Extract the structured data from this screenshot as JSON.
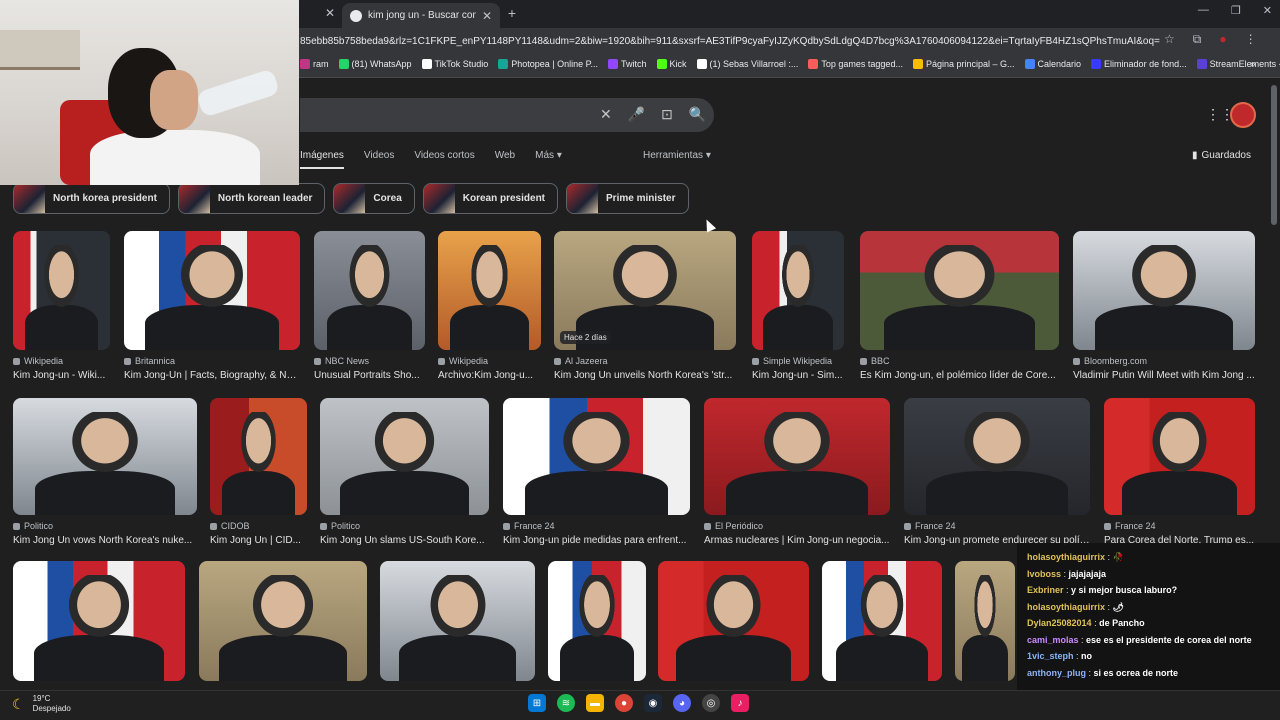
{
  "browser": {
    "active_tab_title": "kim jong un - Buscar con Goog",
    "url": "85ebb85b758beda9&rlz=1C1FKPE_enPY1148PY1148&udm=2&biw=1920&bih=911&sxsrf=AE3TifP9cyaFyIJZyKQdbySdLdgQ4D7bcg%3A1760406094122&ei=TqrtaIyFB4HZ1sQPhsTmuAI&oq=KIM+JON&gs_l...",
    "bookmarks": [
      {
        "label": "ram",
        "color": "#c13584"
      },
      {
        "label": "(81) WhatsApp",
        "color": "#25d366"
      },
      {
        "label": "TikTok Studio",
        "color": "#ffffff"
      },
      {
        "label": "Photopea | Online P...",
        "color": "#18a497"
      },
      {
        "label": "Twitch",
        "color": "#9146ff"
      },
      {
        "label": "Kick",
        "color": "#53fc18"
      },
      {
        "label": "(1) Sebas Villarroel :...",
        "color": "#ffffff"
      },
      {
        "label": "Top games tagged...",
        "color": "#fa5c5c"
      },
      {
        "label": "Página principal – G...",
        "color": "#fbbc04"
      },
      {
        "label": "Calendario",
        "color": "#4285f4"
      },
      {
        "label": "Eliminador de fond...",
        "color": "#3a3aff"
      },
      {
        "label": "StreamElements - O...",
        "color": "#5a3fd9"
      }
    ]
  },
  "google": {
    "tabs": [
      "Imágenes",
      "Videos",
      "Videos cortos",
      "Web",
      "Más"
    ],
    "tools_label": "Herramientas",
    "saved_label": "Guardados",
    "chips": [
      "North korea president",
      "North korean leader",
      "Corea",
      "Korean president",
      "Prime minister"
    ],
    "results_row1": [
      {
        "source": "Wikipedia",
        "title": "Kim Jong-un - Wiki..."
      },
      {
        "source": "Britannica",
        "title": "Kim Jong-Un | Facts, Biography, & Nu..."
      },
      {
        "source": "NBC News",
        "title": "Unusual Portraits Sho..."
      },
      {
        "source": "Wikipedia",
        "title": "Archivo:Kim Jong-u..."
      },
      {
        "source": "Al Jazeera",
        "title": "Kim Jong Un unveils North Korea's 'str...",
        "badge": "Hace 2 días"
      },
      {
        "source": "Simple Wikipedia",
        "title": "Kim Jong-un - Sim..."
      },
      {
        "source": "BBC",
        "title": "Es Kim Jong-un, el polémico líder de Core..."
      },
      {
        "source": "Bloomberg.com",
        "title": "Vladimir Putin Will Meet with Kim Jong ..."
      }
    ],
    "results_row2": [
      {
        "source": "Politico",
        "title": "Kim Jong Un vows North Korea's nuke..."
      },
      {
        "source": "CIDOB",
        "title": "Kim Jong Un | CID..."
      },
      {
        "source": "Politico",
        "title": "Kim Jong Un slams US-South Kore..."
      },
      {
        "source": "France 24",
        "title": "Kim Jong-un pide medidas para enfrent..."
      },
      {
        "source": "El Periódico",
        "title": "Armas nucleares | Kim Jong-un negocia..."
      },
      {
        "source": "France 24",
        "title": "Kim Jong-un promete endurecer su polít..."
      },
      {
        "source": "France 24",
        "title": "Para Corea del Norte, Trump es..."
      }
    ]
  },
  "chat": [
    {
      "user": "holasoythiaguirrix",
      "color": "#e0c25a",
      "text": "🥀"
    },
    {
      "user": "Ivoboss",
      "color": "#e0c25a",
      "text": "jajajajaja"
    },
    {
      "user": "Exbriner",
      "color": "#e0c25a",
      "text": "y si mejor busca laburo?"
    },
    {
      "user": "holasoythiaguirrix",
      "color": "#e0c25a",
      "text": "🌶"
    },
    {
      "user": "Dylan25082014",
      "color": "#e0c25a",
      "text": "de Pancho"
    },
    {
      "user": "cami_molas",
      "color": "#c98bff",
      "text": "ese es el presidente de corea del norte"
    },
    {
      "user": "1vic_steph",
      "color": "#8ab4f8",
      "text": "no"
    },
    {
      "user": "anthony_plug",
      "color": "#8ab4f8",
      "text": "si es ocrea de norte"
    }
  ],
  "taskbar": {
    "temperature": "19°C",
    "weather": "Despejado"
  },
  "colors": {
    "page_bg": "#1f1f1f",
    "flag_red": "#c8232c",
    "flag_blue": "#1f4fa3"
  }
}
